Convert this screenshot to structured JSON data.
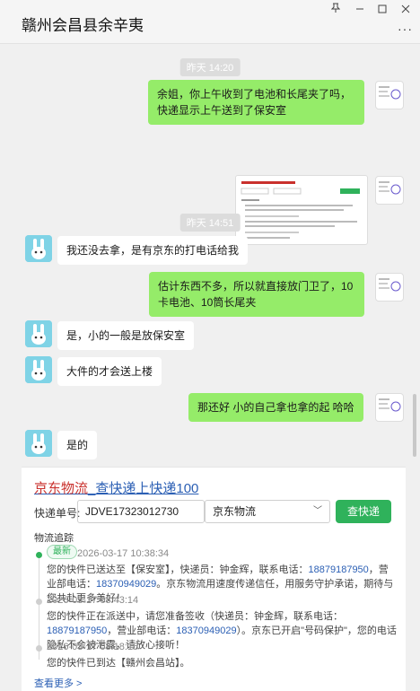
{
  "window": {
    "title": "赣州会昌县余辛夷",
    "pin_icon": "pin-icon",
    "minimize_icon": "minimize-icon",
    "maximize_icon": "maximize-icon",
    "close_icon": "close-icon",
    "more_icon": "more-icon"
  },
  "chat": {
    "time1": "昨天 14:20",
    "msg1": "余姐，你上午收到了电池和长尾夹了吗，快递显示上午送到了保安室",
    "time2": "昨天 14:51",
    "msg2": "我还没去拿，是有京东的打电话给我",
    "msg3": "估计东西不多，所以就直接放门卫了，10卡电池、10筒长尾夹",
    "msg4": "是，小的一般是放保安室",
    "msg5": "大件的才会送上楼",
    "msg6": "那还好   小的自己拿也拿的起  哈哈",
    "msg7": "是的"
  },
  "card": {
    "title_part1": "京东物流",
    "title_part2": "_查快递上快递100",
    "tracking_label": "快递单号:",
    "tracking_number": "JDVE17323012730",
    "carrier": "京东物流",
    "query_button": "查快递",
    "track_header": "物流追踪",
    "latest_badge": "最新",
    "events": [
      {
        "time": "2026-03-17 10:38:34",
        "text_a": "您的快件已送达至【保安室】，快递员：钟金辉，联系电话：",
        "tel1": "18879187950",
        "text_b": "，营业部电话：",
        "tel2": "18370949029",
        "text_c": "。京东物流用速度传递信任，用服务守护承诺，期待与您共赴更多美好！"
      },
      {
        "time": "2026-03-17 08:43:14",
        "text_a": "您的快件正在派送中，请您准备签收（快递员：钟金辉，联系电话：",
        "tel1": "18879187950",
        "text_b": "，营业部电话：",
        "tel2": "18370949029",
        "text_c": "）。京东已开启\"号码保护\"，您的电话隐私不会被泄露，请放心接听！"
      },
      {
        "time": "2026-03-17 08:18:15",
        "text_a": "您的快件已到达【赣州会昌站】。"
      }
    ],
    "see_more": "查看更多 >"
  }
}
